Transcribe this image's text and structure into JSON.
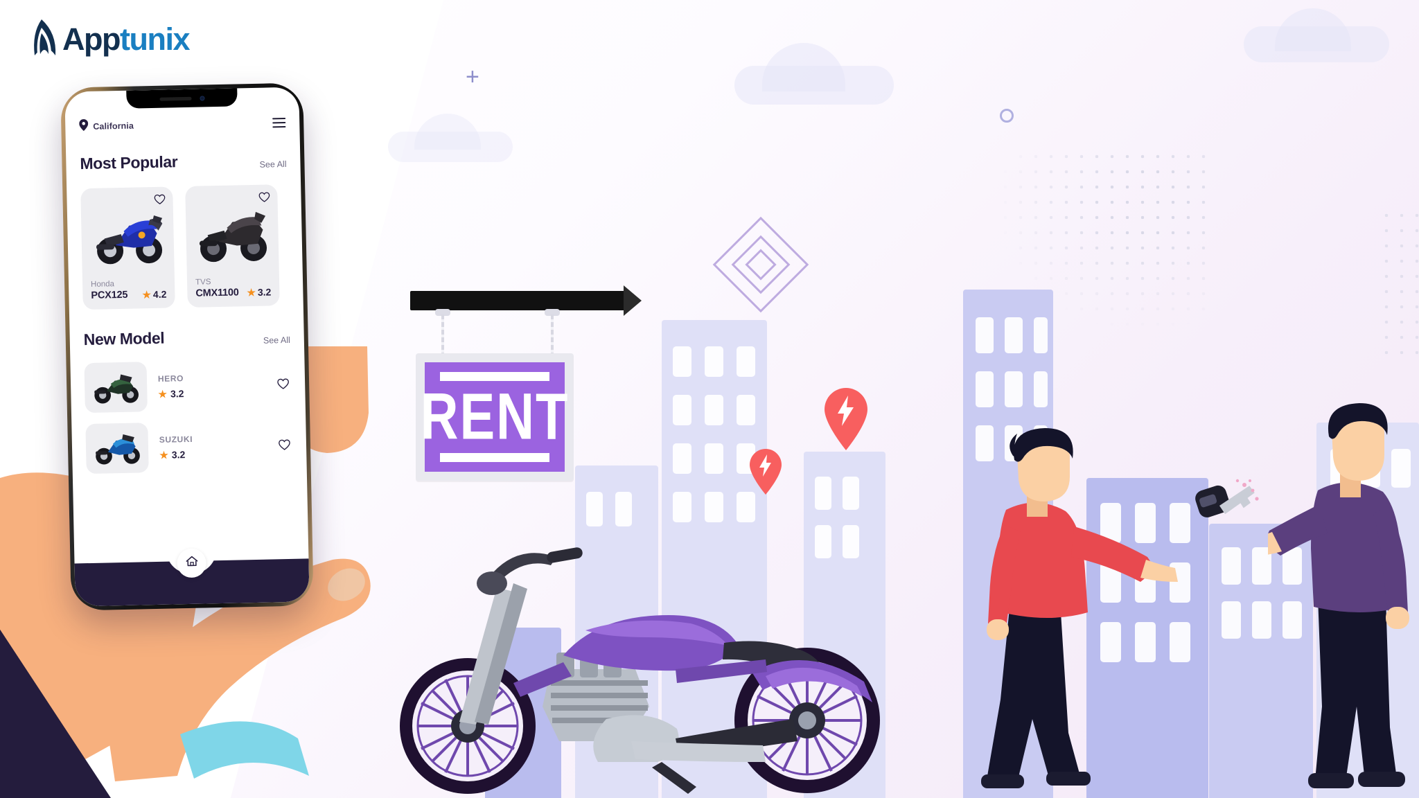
{
  "brand": {
    "logo_app": "App",
    "logo_tunix": "tunix",
    "color_dark": "#13304f",
    "color_blue": "#1a7fc1"
  },
  "phone": {
    "status": {
      "location_label": "California",
      "location_icon": "map-pin-icon",
      "menu_icon": "hamburger-menu-icon"
    },
    "sections": [
      {
        "title": "Most Popular",
        "see_all": "See All",
        "cards": [
          {
            "brand": "Honda",
            "model": "PCX125",
            "rating": "4.2",
            "favorite_icon": "heart-outline-icon",
            "image": "blue-sportbike-image"
          },
          {
            "brand": "TVS",
            "model": "CMX1100",
            "rating": "3.2",
            "favorite_icon": "heart-outline-icon",
            "image": "black-sportbike-image"
          }
        ]
      },
      {
        "title": "New Model",
        "see_all": "See All",
        "items": [
          {
            "brand": "HERO",
            "rating": "3.2",
            "favorite_icon": "heart-outline-icon",
            "image": "green-streetbike-image"
          },
          {
            "brand": "SUZUKI",
            "rating": "3.2",
            "favorite_icon": "heart-outline-icon",
            "image": "blue-sportbike-image"
          }
        ]
      }
    ],
    "bottom_nav": {
      "home_icon": "home-icon"
    },
    "star_icon": "star-icon",
    "star_color": "#f5901f"
  },
  "illustration": {
    "rent_sign": {
      "text": "RENT",
      "board_color": "#9b63e0",
      "frame_color": "#e9e9ef",
      "text_color": "#ffffff"
    },
    "map_pins": [
      {
        "icon": "lightning-bolt-pin-icon",
        "color": "#f85f5f",
        "size": "small"
      },
      {
        "icon": "lightning-bolt-pin-icon",
        "color": "#f85f5f",
        "size": "large"
      }
    ],
    "motorcycle": {
      "name": "purple-chopper-motorcycle",
      "accent_color": "#8b5fd0"
    },
    "people": [
      {
        "name": "person-red-shirt",
        "shirt_color": "#e8494f"
      },
      {
        "name": "person-purple-shirt",
        "shirt_color": "#5b3f7e"
      }
    ],
    "key_handoff": {
      "name": "car-key-icon"
    },
    "city": {
      "name": "city-skyline",
      "colors": [
        "#dfe0f7",
        "#c9cbf2",
        "#b9bcee"
      ]
    },
    "hand": {
      "name": "hand-holding-phone"
    },
    "decor": {
      "plus": "+",
      "diamond_color": "#b39ddb",
      "cloud_color": "#e6e6f8",
      "dot_color": "#d9d9e8"
    }
  }
}
